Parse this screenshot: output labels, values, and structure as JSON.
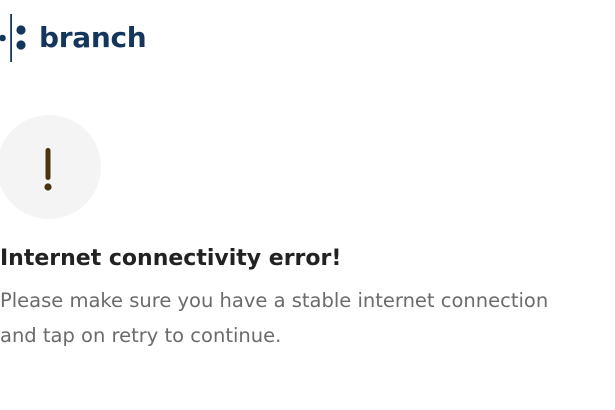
{
  "brand": {
    "logo_icon": "branch-dots-logo-icon",
    "name": "branch",
    "color": "#14365c"
  },
  "alert": {
    "icon": "exclamation-icon",
    "circle_color": "#f4f4f4",
    "mark_color": "#4a3410"
  },
  "error": {
    "title": "Internet connectivity error!",
    "message_line_1": "Please make sure you have a stable internet connection",
    "message_line_2": "and tap on retry to continue."
  }
}
